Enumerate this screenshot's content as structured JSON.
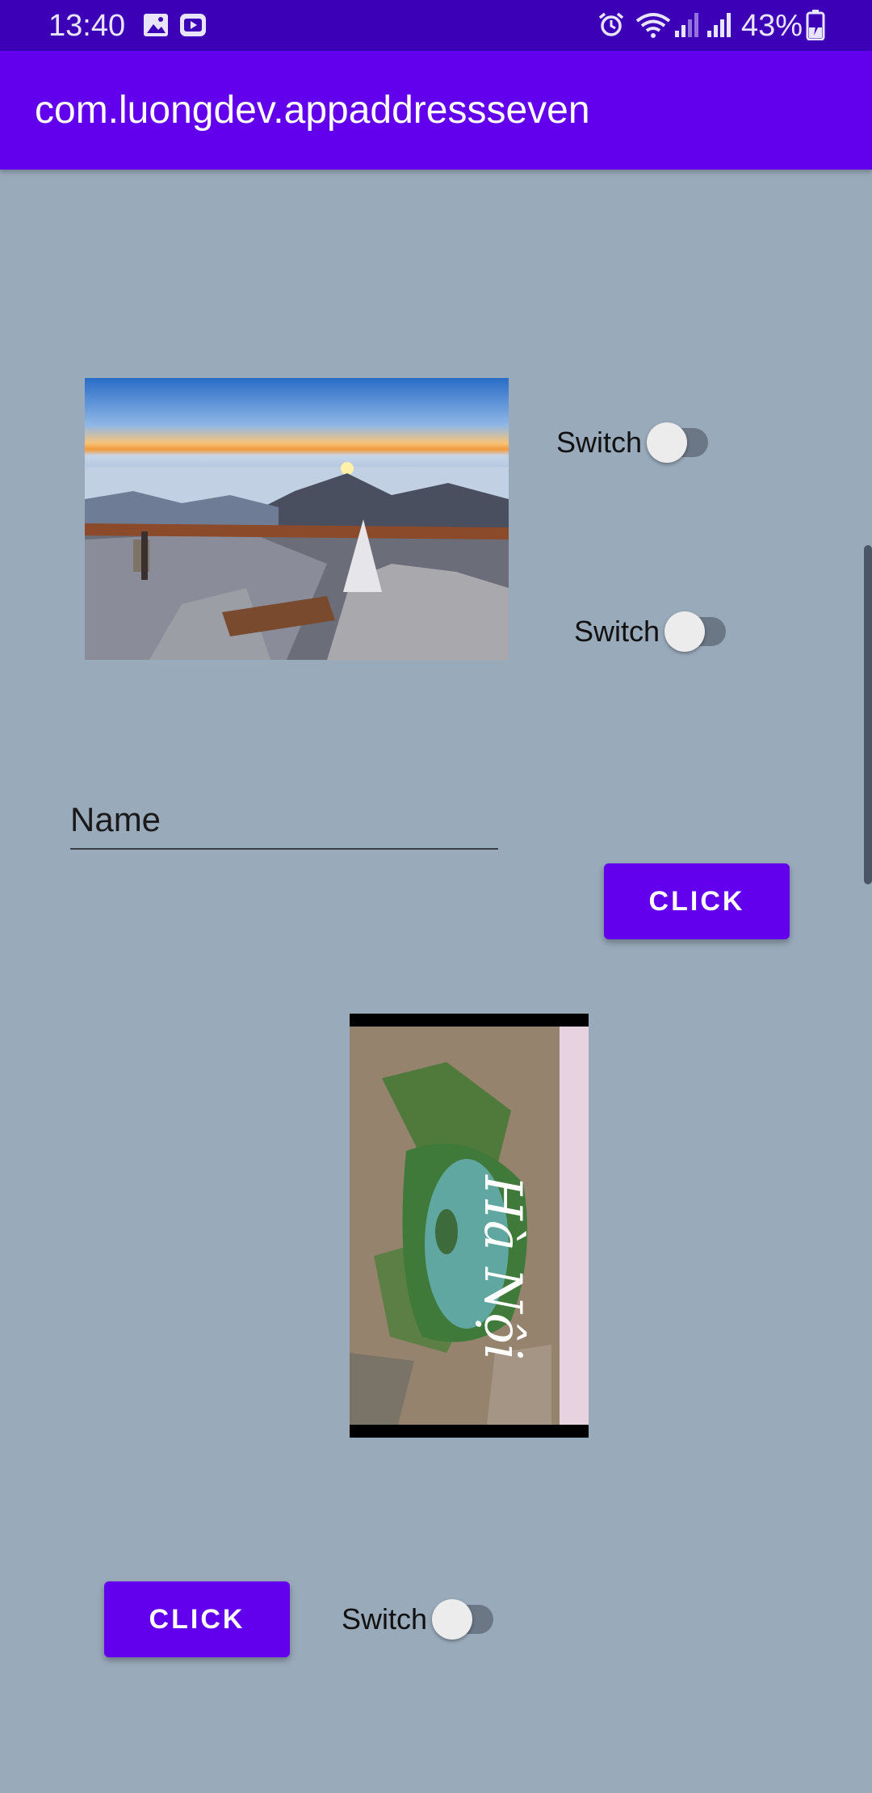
{
  "status_bar": {
    "time": "13:40",
    "battery": "43%",
    "icons": [
      "gallery-icon",
      "video-icon",
      "alarm-icon",
      "wifi-icon",
      "signal-icon",
      "signal-icon",
      "battery-charging-icon"
    ]
  },
  "app_bar": {
    "title": "com.luongdev.appaddressseven"
  },
  "switches": [
    {
      "label": "Switch",
      "checked": false
    },
    {
      "label": "Switch",
      "checked": false
    },
    {
      "label": "Switch",
      "checked": false
    }
  ],
  "name_field": {
    "placeholder": "Name",
    "value": ""
  },
  "buttons": {
    "top_label": "CLICK",
    "bottom_label": "CLICK"
  },
  "colors": {
    "primary": "#6200ee",
    "status_bar": "#3c00b7",
    "background": "#99aabb"
  }
}
